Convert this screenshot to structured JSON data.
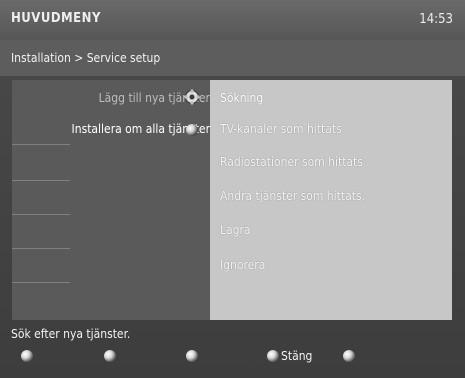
{
  "header": {
    "title": "HUVUDMENY",
    "clock": "14:53"
  },
  "breadcrumb": "Installation > Service setup",
  "menu": {
    "left_items": [
      "Lägg till nya tjänster",
      "Installera om alla tjänster"
    ],
    "right_items": [
      "Sökning",
      "TV-kanaler som hittats",
      "Radiostationer som hittats",
      "Andra tjänster som hittats.",
      "Lagra",
      "Ignorera"
    ]
  },
  "status": "Sök efter nya tjänster.",
  "footer": {
    "close_label": "Stäng"
  }
}
